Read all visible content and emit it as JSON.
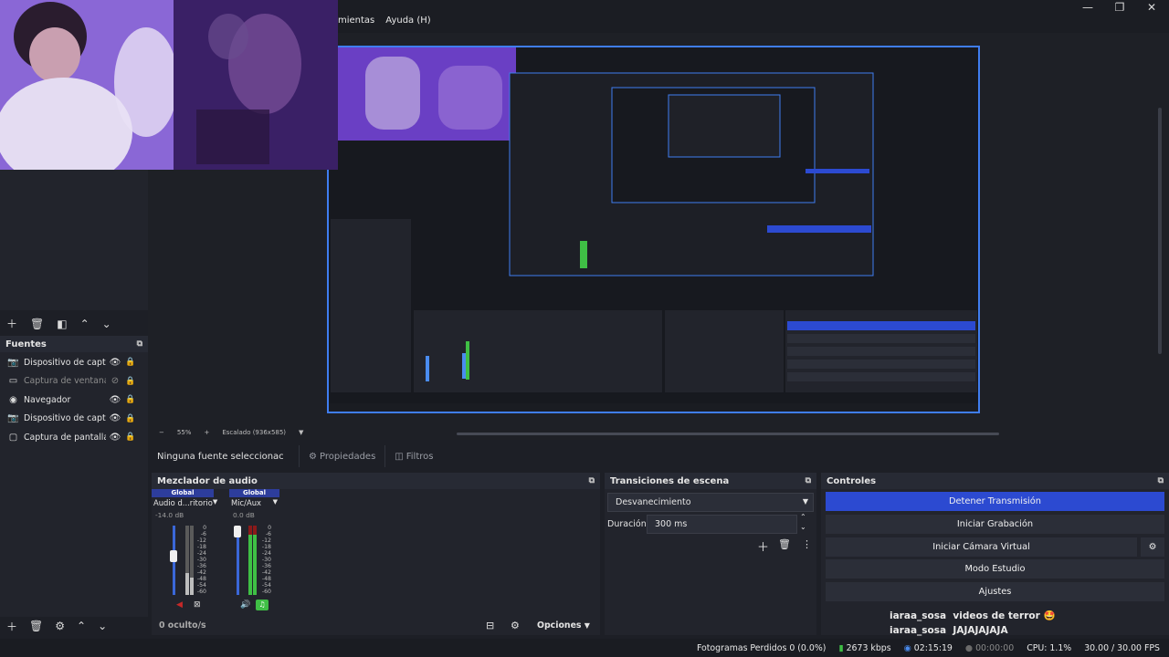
{
  "menu": {
    "items": [
      "mientas",
      "Ayuda (H)"
    ]
  },
  "window_controls": {
    "minimize": "—",
    "maximize": "❐",
    "close": "✕"
  },
  "sources": {
    "title": "Fuentes",
    "items": [
      {
        "label": "Dispositivo de captu",
        "icon": "camera-icon",
        "visible": true
      },
      {
        "label": "Captura de ventana",
        "icon": "window-icon",
        "visible": false
      },
      {
        "label": "Navegador",
        "icon": "globe-icon",
        "visible": true
      },
      {
        "label": "Dispositivo de captu",
        "icon": "camera-icon",
        "visible": true
      },
      {
        "label": "Captura de pantalla",
        "icon": "monitor-icon",
        "visible": true
      }
    ]
  },
  "zoom": {
    "percent": "55%",
    "scale_label": "Escalado (936x585)"
  },
  "source_bar": {
    "no_source": "Ninguna fuente seleccionac",
    "properties": "Propiedades",
    "filters": "Filtros"
  },
  "mixer": {
    "title": "Mezclador de audio",
    "hidden_count": "0 oculto/s",
    "options": "Opciones",
    "channels": [
      {
        "tag": "Global",
        "name": "Audio d...ritorio",
        "db": "-14.0 dB",
        "volume": 0.55,
        "muted": true
      },
      {
        "tag": "Global",
        "name": "Mic/Aux",
        "db": "0.0 dB",
        "volume": 1.0,
        "muted": false
      }
    ],
    "scale": [
      "0",
      "-6",
      "-12",
      "-18",
      "-24",
      "-30",
      "-36",
      "-42",
      "-48",
      "-54",
      "-60"
    ]
  },
  "transitions": {
    "title": "Transiciones de escena",
    "type": "Desvanecimiento",
    "duration_label": "Duración",
    "duration": "300 ms"
  },
  "controls": {
    "title": "Controles",
    "stop_streaming": "Detener Transmisión",
    "start_recording": "Iniciar Grabación",
    "start_virtual_cam": "Iniciar Cámara Virtual",
    "studio_mode": "Modo Estudio",
    "settings": "Ajustes"
  },
  "chat": [
    {
      "user": "iaraa_sosa",
      "message": "videos de terror 🤩"
    },
    {
      "user": "iaraa_sosa",
      "message": "JAJAJAJAJA"
    }
  ],
  "status": {
    "dropped_frames": "Fotogramas Perdidos 0 (0.0%)",
    "bitrate": "2673 kbps",
    "stream_time": "02:15:19",
    "rec_time": "00:00:00",
    "cpu": "CPU: 1.1%",
    "fps": "30.00 / 30.00 FPS"
  },
  "colors": {
    "accent": "#2c4ad1",
    "panel": "#22242c",
    "background": "#1d1f26"
  }
}
